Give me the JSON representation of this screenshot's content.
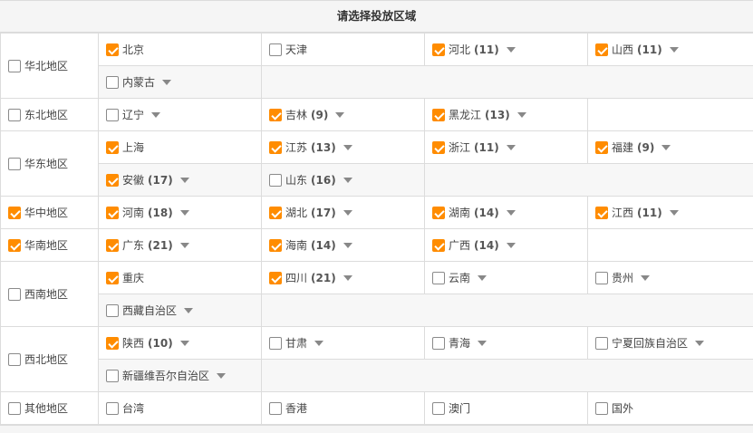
{
  "title": "请选择投放区域",
  "regions": {
    "huabei": {
      "label": "华北地区",
      "checked": false,
      "provinces": [
        {
          "name": "北京",
          "count": "",
          "checked": true,
          "caret": false
        },
        {
          "name": "天津",
          "count": "",
          "checked": false,
          "caret": false
        },
        {
          "name": "河北",
          "count": "(11)",
          "checked": true,
          "caret": true
        },
        {
          "name": "山西",
          "count": "(11)",
          "checked": true,
          "caret": true
        },
        {
          "name": "内蒙古",
          "count": "",
          "checked": false,
          "caret": true
        }
      ]
    },
    "dongbei": {
      "label": "东北地区",
      "checked": false,
      "provinces": [
        {
          "name": "辽宁",
          "count": "",
          "checked": false,
          "caret": true
        },
        {
          "name": "吉林",
          "count": "(9)",
          "checked": true,
          "caret": true
        },
        {
          "name": "黑龙江",
          "count": "(13)",
          "checked": true,
          "caret": true
        }
      ]
    },
    "huadong": {
      "label": "华东地区",
      "checked": false,
      "provinces": [
        {
          "name": "上海",
          "count": "",
          "checked": true,
          "caret": false
        },
        {
          "name": "江苏",
          "count": "(13)",
          "checked": true,
          "caret": true
        },
        {
          "name": "浙江",
          "count": "(11)",
          "checked": true,
          "caret": true
        },
        {
          "name": "福建",
          "count": "(9)",
          "checked": true,
          "caret": true
        },
        {
          "name": "安徽",
          "count": "(17)",
          "checked": true,
          "caret": true
        },
        {
          "name": "山东",
          "count": "(16)",
          "checked": false,
          "caret": true
        }
      ]
    },
    "huazhong": {
      "label": "华中地区",
      "checked": true,
      "provinces": [
        {
          "name": "河南",
          "count": "(18)",
          "checked": true,
          "caret": true
        },
        {
          "name": "湖北",
          "count": "(17)",
          "checked": true,
          "caret": true
        },
        {
          "name": "湖南",
          "count": "(14)",
          "checked": true,
          "caret": true
        },
        {
          "name": "江西",
          "count": "(11)",
          "checked": true,
          "caret": true
        }
      ]
    },
    "huanan": {
      "label": "华南地区",
      "checked": true,
      "provinces": [
        {
          "name": "广东",
          "count": "(21)",
          "checked": true,
          "caret": true
        },
        {
          "name": "海南",
          "count": "(14)",
          "checked": true,
          "caret": true
        },
        {
          "name": "广西",
          "count": "(14)",
          "checked": true,
          "caret": true
        }
      ]
    },
    "xinan": {
      "label": "西南地区",
      "checked": false,
      "provinces": [
        {
          "name": "重庆",
          "count": "",
          "checked": true,
          "caret": false
        },
        {
          "name": "四川",
          "count": "(21)",
          "checked": true,
          "caret": true
        },
        {
          "name": "云南",
          "count": "",
          "checked": false,
          "caret": true
        },
        {
          "name": "贵州",
          "count": "",
          "checked": false,
          "caret": true
        },
        {
          "name": "西藏自治区",
          "count": "",
          "checked": false,
          "caret": true
        }
      ]
    },
    "xibei": {
      "label": "西北地区",
      "checked": false,
      "provinces": [
        {
          "name": "陕西",
          "count": "(10)",
          "checked": true,
          "caret": true
        },
        {
          "name": "甘肃",
          "count": "",
          "checked": false,
          "caret": true
        },
        {
          "name": "青海",
          "count": "",
          "checked": false,
          "caret": true
        },
        {
          "name": "宁夏回族自治区",
          "count": "",
          "checked": false,
          "caret": true
        },
        {
          "name": "新疆维吾尔自治区",
          "count": "",
          "checked": false,
          "caret": true
        }
      ]
    },
    "qita": {
      "label": "其他地区",
      "checked": false,
      "provinces": [
        {
          "name": "台湾",
          "count": "",
          "checked": false,
          "caret": false
        },
        {
          "name": "香港",
          "count": "",
          "checked": false,
          "caret": false
        },
        {
          "name": "澳门",
          "count": "",
          "checked": false,
          "caret": false
        },
        {
          "name": "国外",
          "count": "",
          "checked": false,
          "caret": false
        }
      ]
    }
  },
  "colors": {
    "accent": "#ff8c00",
    "border": "#dcdcdc",
    "header_bg": "#f5f5f5"
  }
}
